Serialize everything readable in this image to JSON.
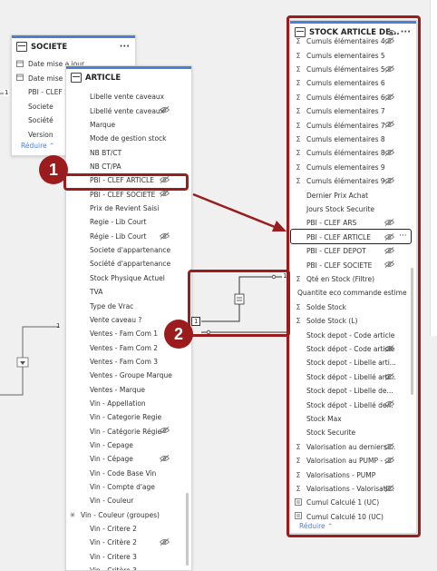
{
  "societe": {
    "title": "SOCIETE",
    "rows": [
      "Date mise a jour",
      "Date mise à jour",
      "PBI - CLEF SOCIETE",
      "Societe",
      "Société",
      "Version"
    ],
    "reduce": "Réduire"
  },
  "article": {
    "title": "ARTICLE",
    "rows": [
      {
        "label": "Libelle vente caveaux",
        "hidden": false
      },
      {
        "label": "Libellé vente caveaux",
        "hidden": true
      },
      {
        "label": "Marque",
        "hidden": false
      },
      {
        "label": "Mode de gestion stock",
        "hidden": false
      },
      {
        "label": "NB BT/CT",
        "hidden": false
      },
      {
        "label": "NB CT/PA",
        "hidden": false
      },
      {
        "label": "PBI - CLEF ARTICLE",
        "hidden": true
      },
      {
        "label": "PBI - CLEF SOCIETE",
        "hidden": true
      },
      {
        "label": "Prix de Revient Saisi",
        "hidden": false
      },
      {
        "label": "Regie - Lib Court",
        "hidden": false
      },
      {
        "label": "Régie - Lib Court",
        "hidden": true
      },
      {
        "label": "Societe d'appartenance",
        "hidden": false
      },
      {
        "label": "Société d'appartenance",
        "hidden": false
      },
      {
        "label": "Stock Physique Actuel",
        "hidden": false
      },
      {
        "label": "TVA",
        "hidden": false
      },
      {
        "label": "Type de Vrac",
        "hidden": false
      },
      {
        "label": "Vente caveau ?",
        "hidden": false
      },
      {
        "label": "Ventes - Fam Com 1",
        "hidden": false
      },
      {
        "label": "Ventes - Fam Com 2",
        "hidden": false
      },
      {
        "label": "Ventes - Fam Com 3",
        "hidden": false
      },
      {
        "label": "Ventes - Groupe Marque",
        "hidden": false
      },
      {
        "label": "Ventes - Marque",
        "hidden": false
      },
      {
        "label": "Vin - Appellation",
        "hidden": false
      },
      {
        "label": "Vin - Categorie Regie",
        "hidden": false
      },
      {
        "label": "Vin - Catégorie Régie",
        "hidden": true
      },
      {
        "label": "Vin - Cepage",
        "hidden": false
      },
      {
        "label": "Vin - Cépage",
        "hidden": true
      },
      {
        "label": "Vin - Code Base Vin",
        "hidden": false
      },
      {
        "label": "Vin - Compte d'age",
        "hidden": false
      },
      {
        "label": "Vin - Couleur",
        "hidden": false
      },
      {
        "label": "Vin - Couleur (groupes)",
        "hidden": false
      },
      {
        "label": "Vin - Critere 2",
        "hidden": false
      },
      {
        "label": "Vin - Critère 2",
        "hidden": true
      },
      {
        "label": "Vin - Critere 3",
        "hidden": false
      },
      {
        "label": "Vin - Critère 3",
        "hidden": false
      }
    ]
  },
  "stock": {
    "title": "STOCK ARTICLE DE...",
    "rows": [
      {
        "label": "Cumuls élémentaires 4",
        "sigma": true,
        "hidden": true
      },
      {
        "label": "Cumuls elementaires 5",
        "sigma": true,
        "hidden": false
      },
      {
        "label": "Cumuls élémentaires 5",
        "sigma": true,
        "hidden": true
      },
      {
        "label": "Cumuls elementaires 6",
        "sigma": true,
        "hidden": false
      },
      {
        "label": "Cumuls élémentaires 6",
        "sigma": true,
        "hidden": true
      },
      {
        "label": "Cumuls elementaires 7",
        "sigma": true,
        "hidden": false
      },
      {
        "label": "Cumuls élémentaires 7",
        "sigma": true,
        "hidden": true
      },
      {
        "label": "Cumuls elementaires 8",
        "sigma": true,
        "hidden": false
      },
      {
        "label": "Cumuls élémentaires 8",
        "sigma": true,
        "hidden": true
      },
      {
        "label": "Cumuls elementaires 9",
        "sigma": true,
        "hidden": false
      },
      {
        "label": "Cumuls élémentaires 9",
        "sigma": true,
        "hidden": true
      },
      {
        "label": "Dernier Prix Achat",
        "sigma": false,
        "hidden": false
      },
      {
        "label": "Jours Stock Securite",
        "sigma": false,
        "hidden": false
      },
      {
        "label": "PBI - CLEF ARS",
        "sigma": false,
        "hidden": true
      },
      {
        "label": "PBI - CLEF ARTICLE",
        "sigma": false,
        "hidden": true
      },
      {
        "label": "PBI - CLEF DEPOT",
        "sigma": false,
        "hidden": true
      },
      {
        "label": "PBI - CLEF SOCIETE",
        "sigma": false,
        "hidden": true
      },
      {
        "label": "Qté en Stock (Filtre)",
        "sigma": true,
        "hidden": false
      },
      {
        "label": "Quantite eco commande estimee",
        "sigma": false,
        "hidden": false
      },
      {
        "label": "Solde Stock",
        "sigma": true,
        "hidden": false
      },
      {
        "label": "Solde Stock (L)",
        "sigma": true,
        "hidden": false
      },
      {
        "label": "Stock depot - Code article",
        "sigma": false,
        "hidden": false
      },
      {
        "label": "Stock dépot - Code article",
        "sigma": false,
        "hidden": true
      },
      {
        "label": "Stock depot - Libelle arti...",
        "sigma": false,
        "hidden": false
      },
      {
        "label": "Stock dépot - Libellé arti...",
        "sigma": false,
        "hidden": true
      },
      {
        "label": "Stock depot - Libelle de...",
        "sigma": false,
        "hidden": false
      },
      {
        "label": "Stock dépot - Libellé de...",
        "sigma": false,
        "hidden": true
      },
      {
        "label": "Stock Max",
        "sigma": false,
        "hidden": false
      },
      {
        "label": "Stock Securite",
        "sigma": false,
        "hidden": false
      },
      {
        "label": "Valorisation au derniers ...",
        "sigma": true,
        "hidden": true
      },
      {
        "label": "Valorisation au PUMP - ...",
        "sigma": true,
        "hidden": true
      },
      {
        "label": "Valorisations - PUMP",
        "sigma": true,
        "hidden": false
      },
      {
        "label": "Valorisations - Valorisati...",
        "sigma": true,
        "hidden": true
      },
      {
        "label": "Cumul Calculé 1 (UC)",
        "sigma": false,
        "hidden": false
      },
      {
        "label": "Cumul Calculé 10 (UC)",
        "sigma": false,
        "hidden": false
      }
    ],
    "reduce": "Réduire"
  },
  "relationship": {
    "one": "1",
    "many": "1"
  },
  "left_one": "1",
  "left_one2": "1",
  "badges": [
    "1",
    "2"
  ]
}
